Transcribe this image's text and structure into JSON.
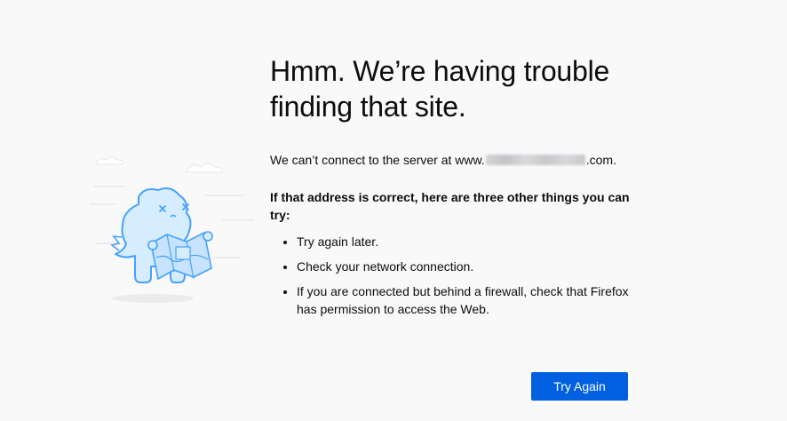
{
  "error": {
    "title_line1": "Hmm. We’re having trouble",
    "title_line2": "finding that site.",
    "desc_prefix": "We can’t connect to the server at www.",
    "desc_suffix": ".com.",
    "subheading": "If that address is correct, here are three other things you can try:",
    "tips": [
      "Try again later.",
      "Check your network connection.",
      "If you are connected but behind a firewall, check that Firefox has permission to access the Web."
    ],
    "try_again_label": "Try Again"
  },
  "illustration": {
    "icon": "confused-dinosaur-with-map-icon",
    "accent_color": "#45a1ff"
  },
  "colors": {
    "background": "#f9f9fa",
    "button": "#0060df",
    "text": "#0c0c0d"
  }
}
